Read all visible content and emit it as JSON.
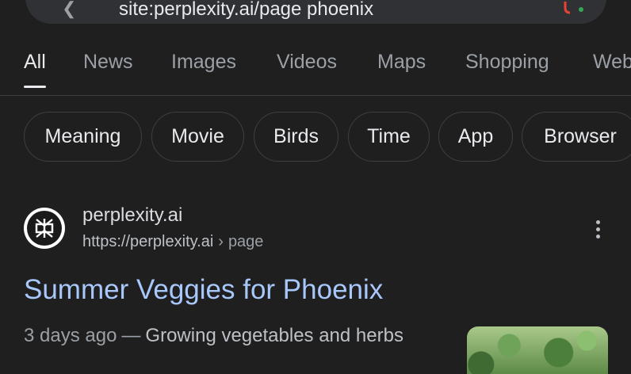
{
  "search": {
    "query": "site:perplexity.ai/page phoenix"
  },
  "tabs": [
    "All",
    "News",
    "Images",
    "Videos",
    "Maps",
    "Shopping",
    "Web"
  ],
  "chips": [
    "Meaning",
    "Movie",
    "Birds",
    "Time",
    "App",
    "Browser"
  ],
  "result": {
    "site_name": "perplexity.ai",
    "url": "https://perplexity.ai",
    "separator": "›",
    "breadcrumb": "page",
    "title": "Summer Veggies for Phoenix",
    "date": "3 days ago",
    "dash": "—",
    "snippet": "Growing vegetables and herbs"
  },
  "icons": {
    "search": "search-icon",
    "lens": "google-lens-icon",
    "favicon": "perplexity-logo-icon",
    "more": "more-vert-icon"
  },
  "colors": {
    "background": "#1f1f1f",
    "link_title": "#a8c7fa",
    "chip_border": "#3c4043"
  }
}
